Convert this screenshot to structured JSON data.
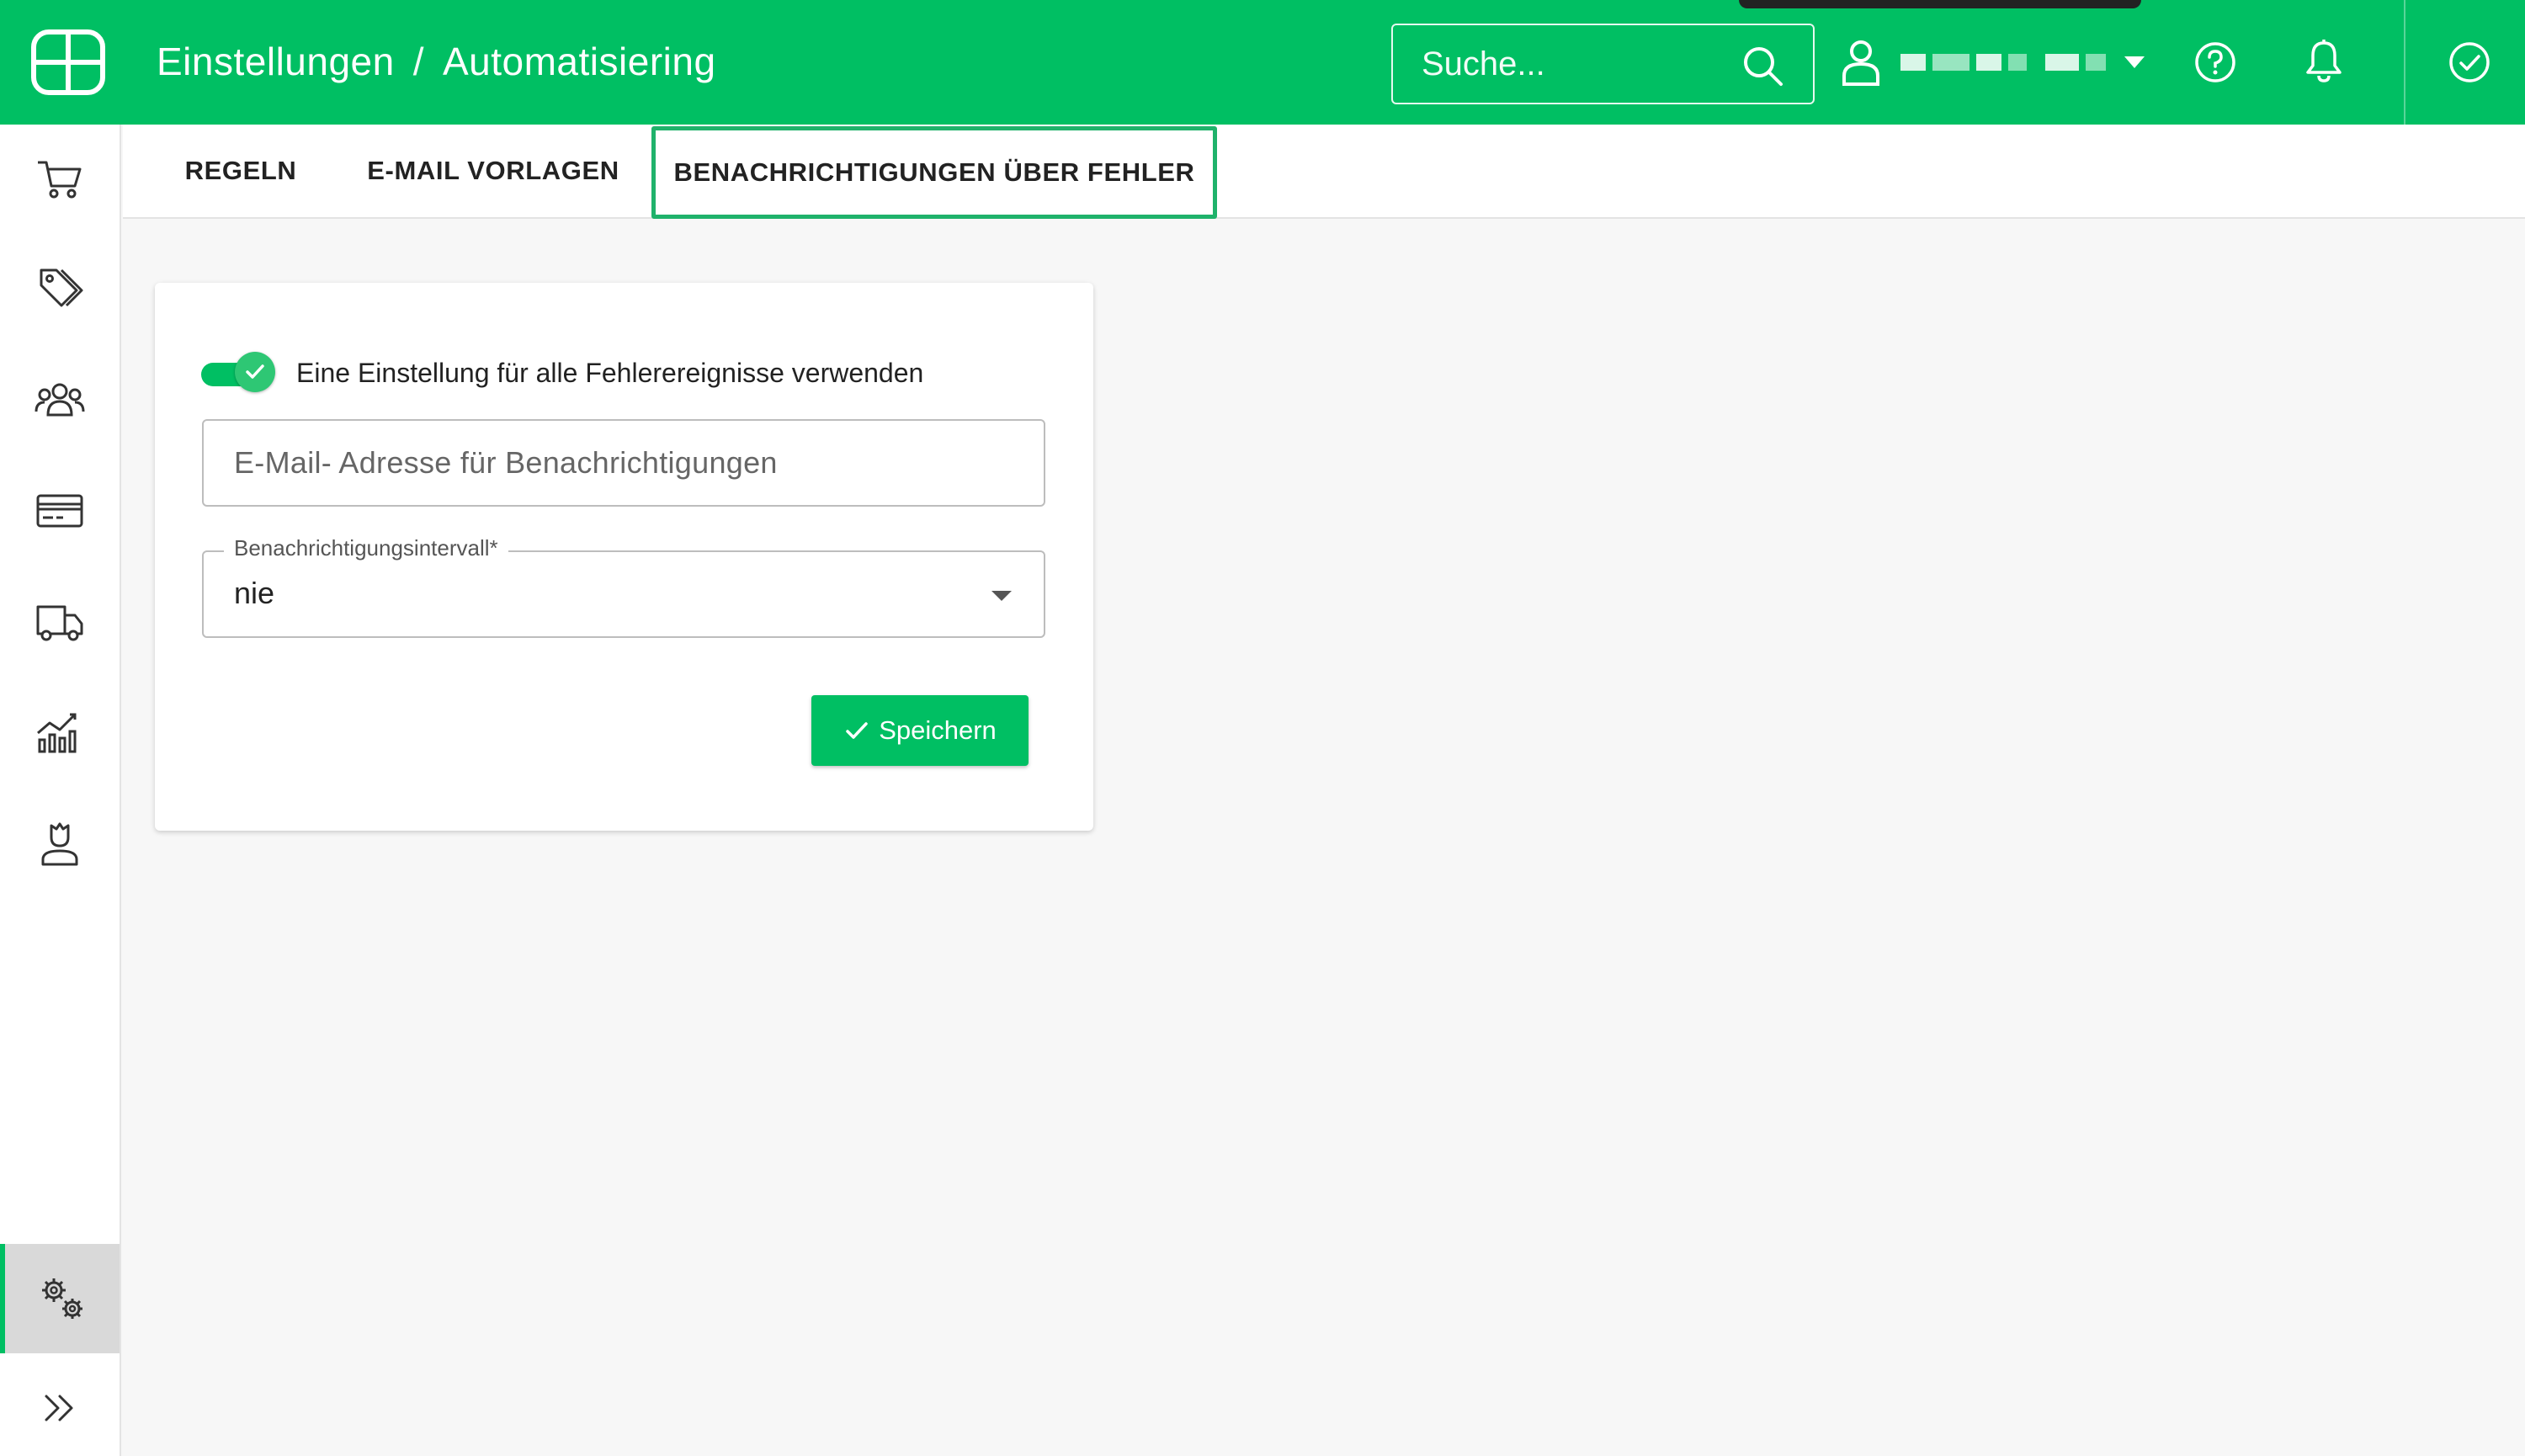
{
  "header": {
    "breadcrumb": [
      "Einstellungen",
      "Automatisiering"
    ],
    "breadcrumb_separator": "/",
    "search_placeholder": "Suche...",
    "icons": [
      "logo-icon",
      "search-icon",
      "user-icon",
      "help-icon",
      "bell-icon",
      "check-circle-icon"
    ]
  },
  "sidebar": {
    "items": [
      {
        "icon": "cart-icon"
      },
      {
        "icon": "tags-icon"
      },
      {
        "icon": "customers-icon"
      },
      {
        "icon": "payment-card-icon"
      },
      {
        "icon": "truck-icon"
      },
      {
        "icon": "analytics-icon"
      },
      {
        "icon": "support-agent-icon"
      },
      {
        "icon": "settings-gears-icon",
        "active": true
      },
      {
        "icon": "expand-chevrons-icon"
      }
    ]
  },
  "tabs": [
    {
      "label": "REGELN"
    },
    {
      "label": "E-MAIL VORLAGEN"
    },
    {
      "label": "BENACHRICHTIGUNGEN ÜBER FEHLER",
      "active": true
    }
  ],
  "form": {
    "toggle_label": "Eine Einstellung für alle Fehlerereignisse verwenden",
    "toggle_on": true,
    "email_placeholder": "E-Mail- Adresse für Benachrichtigungen",
    "interval_label": "Benachrichtigungsintervall*",
    "interval_value": "nie",
    "save_label": "Speichern"
  },
  "colors": {
    "brand": "#00bf63",
    "active_tab_border": "#1fb26b",
    "sidebar_active_bg": "#d9d9d9"
  }
}
